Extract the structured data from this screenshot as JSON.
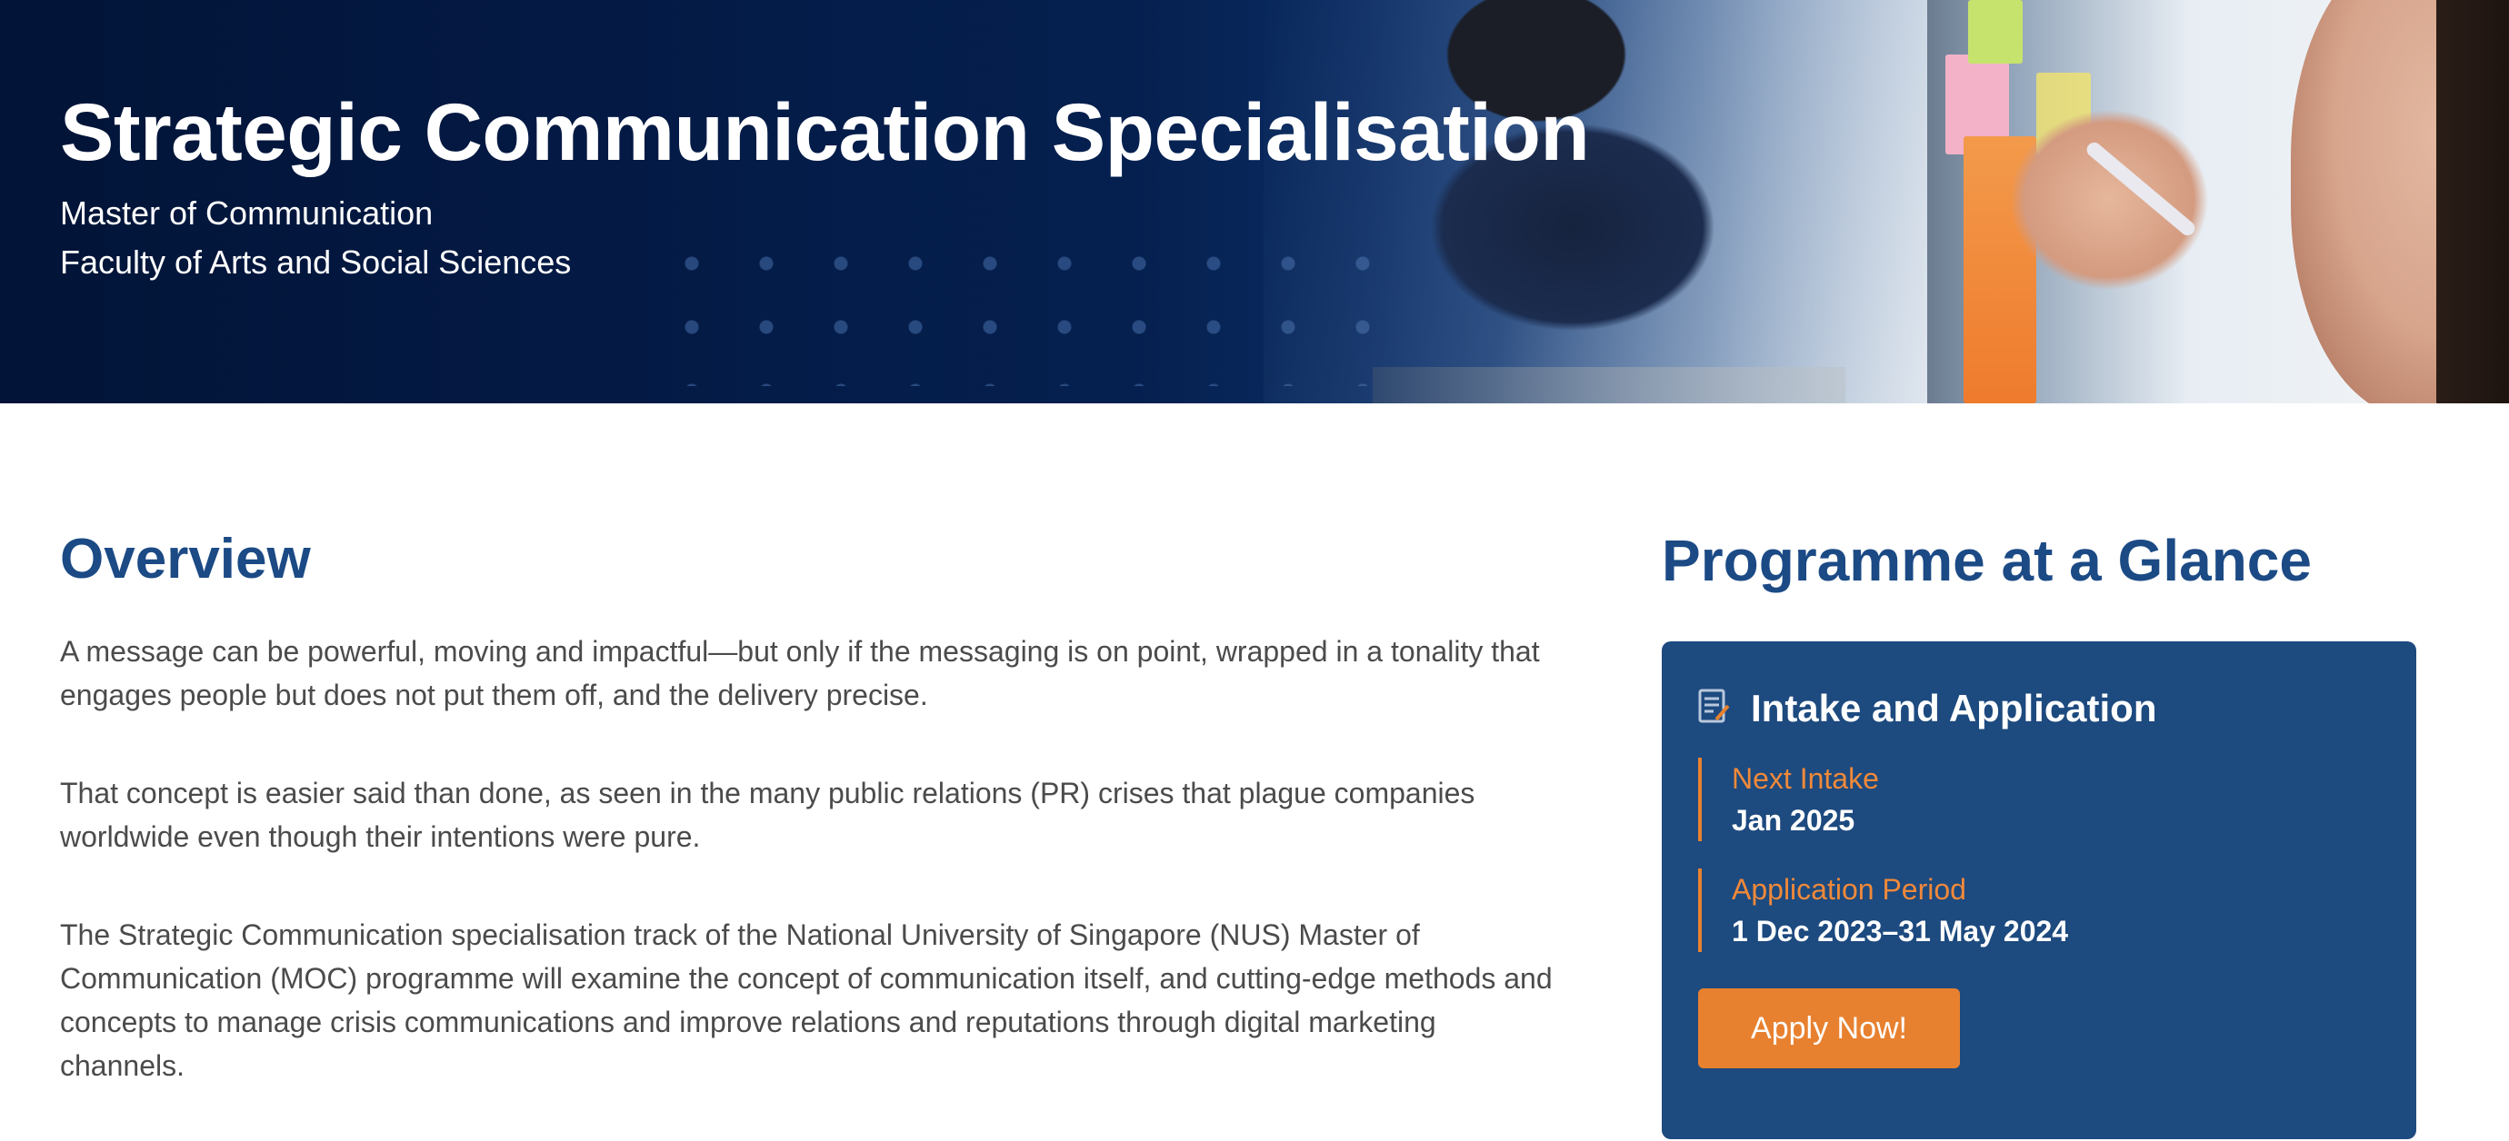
{
  "hero": {
    "title": "Strategic Communication Specialisation",
    "subtitle_line1": "Master of Communication",
    "subtitle_line2": "Faculty of Arts and Social Sciences"
  },
  "overview": {
    "heading": "Overview",
    "paragraphs": [
      "A message can be powerful, moving and impactful—but only if the messaging is on point, wrapped in a tonality that engages people but does not put them off, and the delivery precise.",
      "That concept is easier said than done, as seen in the many public relations (PR) crises that plague companies worldwide even though their intentions were pure.",
      "The Strategic Communication specialisation track of the National University of Singapore (NUS) Master of Communication (MOC) programme will examine the concept of communication itself, and cutting-edge methods and concepts to manage crisis communications and improve relations and reputations through digital marketing channels."
    ]
  },
  "glance": {
    "heading": "Programme at a Glance",
    "card": {
      "icon": "document-edit-icon",
      "title": "Intake and Application",
      "items": [
        {
          "label": "Next Intake",
          "value": "Jan 2025"
        },
        {
          "label": "Application Period",
          "value": "1 Dec 2023–31 May 2024"
        }
      ],
      "apply_label": "Apply Now!"
    }
  },
  "colors": {
    "brand_blue": "#1b4a85",
    "card_bg": "#1d4a7f",
    "accent_orange": "#e8812f",
    "hero_navy": "#041a45"
  }
}
